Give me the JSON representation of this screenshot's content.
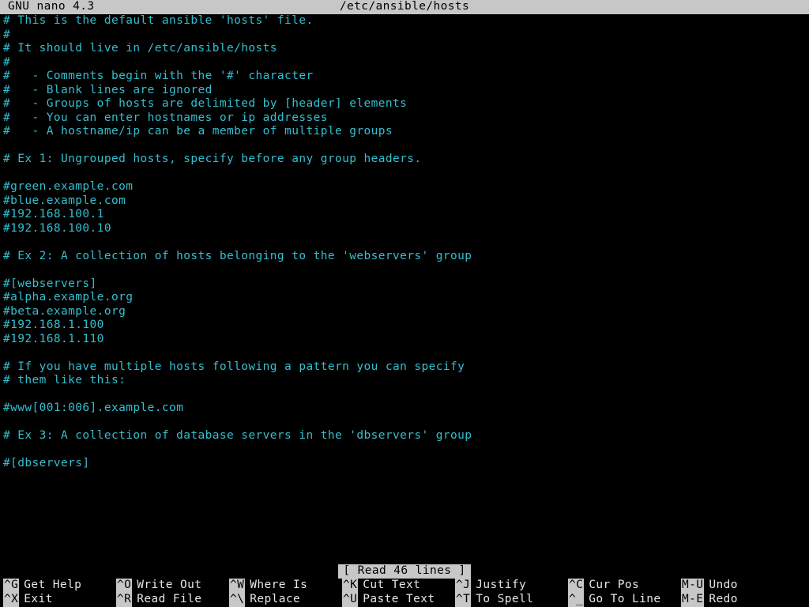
{
  "titlebar": {
    "app": "GNU nano 4.3",
    "filepath": "/etc/ansible/hosts"
  },
  "editor": {
    "lines": [
      "# This is the default ansible 'hosts' file.",
      "#",
      "# It should live in /etc/ansible/hosts",
      "#",
      "#   - Comments begin with the '#' character",
      "#   - Blank lines are ignored",
      "#   - Groups of hosts are delimited by [header] elements",
      "#   - You can enter hostnames or ip addresses",
      "#   - A hostname/ip can be a member of multiple groups",
      "",
      "# Ex 1: Ungrouped hosts, specify before any group headers.",
      "",
      "#green.example.com",
      "#blue.example.com",
      "#192.168.100.1",
      "#192.168.100.10",
      "",
      "# Ex 2: A collection of hosts belonging to the 'webservers' group",
      "",
      "#[webservers]",
      "#alpha.example.org",
      "#beta.example.org",
      "#192.168.1.100",
      "#192.168.1.110",
      "",
      "# If you have multiple hosts following a pattern you can specify",
      "# them like this:",
      "",
      "#www[001:006].example.com",
      "",
      "# Ex 3: A collection of database servers in the 'dbservers' group",
      "",
      "#[dbservers]"
    ]
  },
  "statusbar": {
    "message": "[ Read 46 lines ]"
  },
  "shortcuts": {
    "row1": [
      {
        "key": "^G",
        "label": "Get Help"
      },
      {
        "key": "^O",
        "label": "Write Out"
      },
      {
        "key": "^W",
        "label": "Where Is"
      },
      {
        "key": "^K",
        "label": "Cut Text"
      },
      {
        "key": "^J",
        "label": "Justify"
      },
      {
        "key": "^C",
        "label": "Cur Pos"
      },
      {
        "key": "M-U",
        "label": "Undo"
      }
    ],
    "row2": [
      {
        "key": "^X",
        "label": "Exit"
      },
      {
        "key": "^R",
        "label": "Read File"
      },
      {
        "key": "^\\",
        "label": "Replace"
      },
      {
        "key": "^U",
        "label": "Paste Text"
      },
      {
        "key": "^T",
        "label": "To Spell"
      },
      {
        "key": "^_",
        "label": "Go To Line"
      },
      {
        "key": "M-E",
        "label": "Redo"
      }
    ]
  }
}
